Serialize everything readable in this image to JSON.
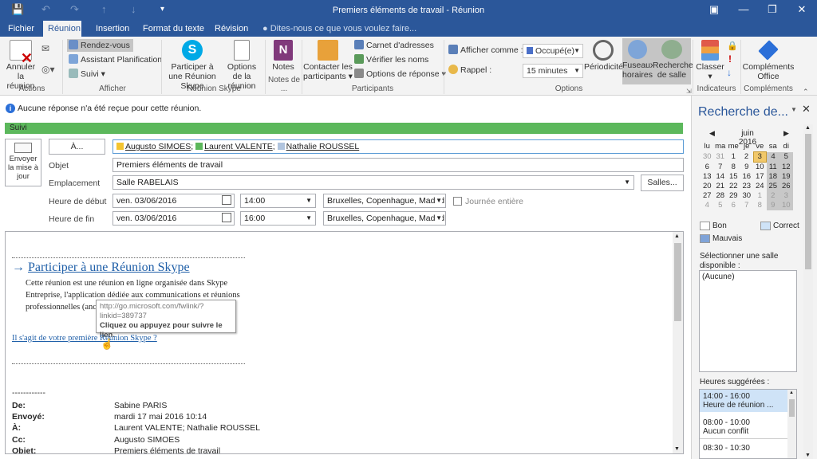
{
  "window": {
    "title": "Premiers éléments de travail - Réunion"
  },
  "tabs": [
    "Fichier",
    "Réunion",
    "Insertion",
    "Format du texte",
    "Révision"
  ],
  "tellme": "Dites-nous ce que vous voulez faire...",
  "ribbon": {
    "annuler": "Annuler la réunion",
    "rendez": "Rendez-vous",
    "assistant": "Assistant Planification",
    "suivi": "Suivi",
    "participer": "Participer à une Réunion Skype",
    "options_reunion": "Options de la réunion",
    "notes": "Notes",
    "contacter": "Contacter les participants",
    "carnet": "Carnet d'adresses",
    "verifier": "Vérifier les noms",
    "options_reponse": "Options de réponse",
    "afficher_comme": "Afficher comme :",
    "afficher_val": "Occupé(e)",
    "rappel": "Rappel :",
    "rappel_val": "15 minutes",
    "periodicite": "Périodicité",
    "fuseaux": "Fuseaux horaires",
    "recherche_salle": "Recherche de salle",
    "classer": "Classer",
    "complements": "Compléments Office",
    "groups": {
      "actions": "Actions",
      "afficher": "Afficher",
      "skype": "Réunion Skype",
      "notes": "Notes de ...",
      "participants": "Participants",
      "options": "Options",
      "indicateurs": "Indicateurs",
      "complements": "Compléments"
    }
  },
  "info": "Aucune réponse n'a été reçue pour cette réunion.",
  "suivi": "Suivi",
  "form": {
    "envoyer": "Envoyer la mise à jour",
    "a_btn": "À...",
    "recipients": [
      {
        "name": "Augusto SIMOES",
        "color": "#f4c430"
      },
      {
        "name": "Laurent VALENTE",
        "color": "#5cb85c"
      },
      {
        "name": "Nathalie ROUSSEL",
        "color": "#b0c4de"
      }
    ],
    "objet_lbl": "Objet",
    "objet": "Premiers éléments de travail",
    "empl_lbl": "Emplacement",
    "empl": "Salle RABELAIS",
    "salles": "Salles...",
    "debut_lbl": "Heure de début",
    "debut_date": "ven. 03/06/2016",
    "debut_time": "14:00",
    "tz": "Bruxelles, Copenhague, Madrid,",
    "journee": "Journée entière",
    "fin_lbl": "Heure de fin",
    "fin_date": "ven. 03/06/2016",
    "fin_time": "16:00"
  },
  "body": {
    "skype_link": "Participer à une Réunion Skype",
    "desc1": "Cette réunion est une réunion en ligne organisée dans Skype",
    "desc2": "Entreprise, l'application dédiée aux communications et réunions",
    "desc3": "professionnelles (anc",
    "tip1": "http://go.microsoft.com/fwlink/?",
    "tip2": "linkid=389737",
    "tip3": "Cliquez ou appuyez pour suivre le lien.",
    "first_link": "Il s'agit de votre première Réunion Skype ?",
    "dashes": "------------",
    "headers": [
      [
        "De:",
        "Sabine PARIS"
      ],
      [
        "Envoyé:",
        "mardi 17 mai 2016 10:14"
      ],
      [
        "À:",
        "Laurent VALENTE; Nathalie ROUSSEL"
      ],
      [
        "Cc:",
        "Augusto SIMOES"
      ],
      [
        "Objet:",
        "Premiers éléments de travail"
      ]
    ]
  },
  "pane": {
    "title": "Recherche de...",
    "month": "juin 2016",
    "days": [
      "lu",
      "ma",
      "me",
      "je",
      "ve",
      "sa",
      "di"
    ],
    "weeks": [
      [
        "30",
        "31",
        "1",
        "2",
        "3",
        "4",
        "5"
      ],
      [
        "6",
        "7",
        "8",
        "9",
        "10",
        "11",
        "12"
      ],
      [
        "13",
        "14",
        "15",
        "16",
        "17",
        "18",
        "19"
      ],
      [
        "20",
        "21",
        "22",
        "23",
        "24",
        "25",
        "26"
      ],
      [
        "27",
        "28",
        "29",
        "30",
        "1",
        "2",
        "3"
      ],
      [
        "4",
        "5",
        "6",
        "7",
        "8",
        "9",
        "10"
      ]
    ],
    "bon": "Bon",
    "correct": "Correct",
    "mauvais": "Mauvais",
    "select_salle": "Sélectionner une salle disponible :",
    "aucune": "(Aucune)",
    "heures": "Heures suggérées :",
    "suggestions": [
      {
        "time": "14:00 - 16:00",
        "sub": "Heure de réunion ..."
      },
      {
        "time": "08:00 - 10:00",
        "sub": "Aucun conflit"
      },
      {
        "time": "08:30 - 10:30",
        "sub": ""
      }
    ]
  }
}
